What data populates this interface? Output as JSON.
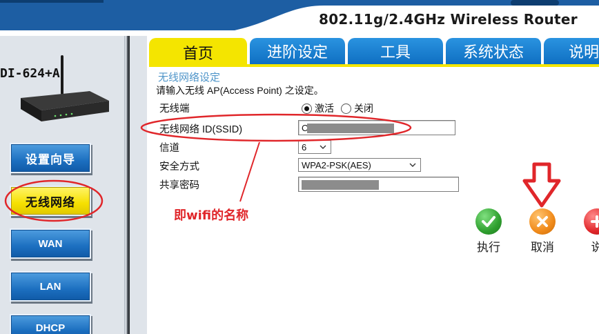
{
  "header": {
    "router_title": "802.11g/2.4GHz Wireless Router"
  },
  "sidebar": {
    "model": "DI-624+A",
    "items": [
      {
        "label": "设置向导"
      },
      {
        "label": "无线网络"
      },
      {
        "label": "WAN"
      },
      {
        "label": "LAN"
      },
      {
        "label": "DHCP"
      }
    ]
  },
  "tabs": [
    {
      "label": "首页"
    },
    {
      "label": "进阶设定"
    },
    {
      "label": "工具"
    },
    {
      "label": "系统状态"
    },
    {
      "label": "说明"
    }
  ],
  "form": {
    "section_title": "无线网络设定",
    "description": "请输入无线 AP(Access Point) 之设定。",
    "wireless": {
      "label": "无线端",
      "options": [
        "激活",
        "关闭"
      ],
      "selected": "激活"
    },
    "ssid": {
      "label": "无线网络 ID(SSID)",
      "value_visible_prefix": "C"
    },
    "channel": {
      "label": "信道",
      "value": "6"
    },
    "security": {
      "label": "安全方式",
      "value": "WPA2-PSK(AES)"
    },
    "passphrase": {
      "label": "共享密码"
    }
  },
  "actions": [
    {
      "label": "执行",
      "icon": "check-icon",
      "color": "#3aa83a"
    },
    {
      "label": "取消",
      "icon": "x-icon",
      "color": "#f08a1a"
    },
    {
      "label": "说",
      "icon": "plus-icon",
      "color": "#e0262a"
    }
  ],
  "annotation": {
    "text": "即wifi的名称",
    "color": "#e0262a"
  },
  "colors": {
    "tab_active": "#f4e500",
    "tab": "#0f6fc2",
    "nav_button": "#1c6fc0",
    "nav_active": "#f6e000",
    "section_title": "#4f95c9"
  }
}
